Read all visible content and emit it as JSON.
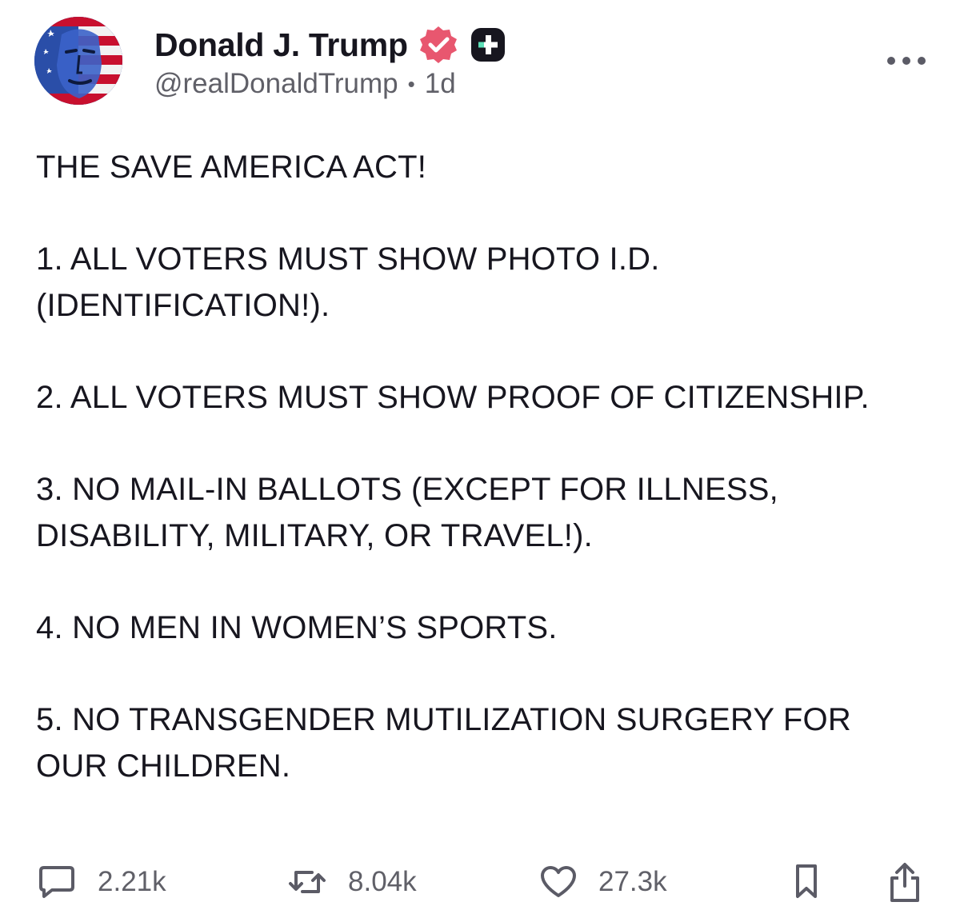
{
  "post": {
    "author": {
      "display_name": "Donald J. Trump",
      "handle": "@realDonaldTrump",
      "separator": "•",
      "time": "1d",
      "verified_icon": "verified-badge-icon",
      "verified_color": "#e8576f",
      "plus_badge_icon": "plus-badge-icon",
      "avatar": "profile-avatar"
    },
    "more_icon": "more-horizontal-icon",
    "paragraphs": [
      "THE SAVE AMERICA ACT!",
      "1. ALL VOTERS MUST SHOW PHOTO I.D. (IDENTIFICATION!).",
      "2. ALL VOTERS MUST SHOW PROOF OF CITIZENSHIP.",
      "3. NO MAIL-IN BALLOTS (EXCEPT FOR ILLNESS, DISABILITY, MILITARY, OR TRAVEL!).",
      "4. NO MEN IN WOMEN’S SPORTS.",
      "5. NO TRANSGENDER MUTILIZATION SURGERY FOR OUR CHILDREN."
    ],
    "actions": {
      "reply": {
        "icon": "reply-icon",
        "count": "2.21k"
      },
      "repost": {
        "icon": "repost-icon",
        "count": "8.04k"
      },
      "like": {
        "icon": "heart-icon",
        "count": "27.3k"
      },
      "bookmark": {
        "icon": "bookmark-icon"
      },
      "share": {
        "icon": "share-icon"
      }
    }
  },
  "colors": {
    "text": "#17161f",
    "secondary": "#606068",
    "icon": "#5b5b66",
    "badge_dark": "#17161f",
    "badge_accent": "#5ee0b8"
  }
}
